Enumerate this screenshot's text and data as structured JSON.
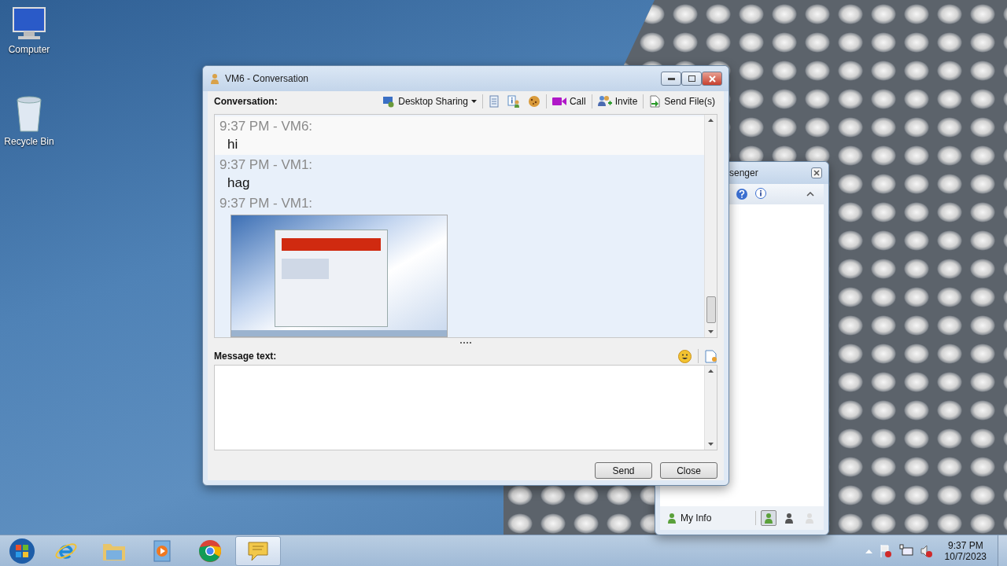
{
  "desktop_icons": [
    {
      "kind": "computer",
      "label": "Computer"
    },
    {
      "kind": "bin",
      "label": "Recycle Bin"
    }
  ],
  "messenger_window": {
    "title": "senger",
    "footer_label": "My Info",
    "statuses": [
      {
        "kind": "online",
        "selected": true
      },
      {
        "kind": "busy",
        "selected": false
      },
      {
        "kind": "offline",
        "selected": false
      }
    ]
  },
  "conversation_window": {
    "title": "VM6 - Conversation",
    "header_label": "Conversation:",
    "toolbar": [
      {
        "kind": "sharing",
        "label": "Desktop Sharing"
      },
      {
        "kind": "notes"
      },
      {
        "kind": "info"
      },
      {
        "kind": "cookie"
      },
      {
        "kind": "call",
        "label": "Call"
      },
      {
        "kind": "invite",
        "label": "Invite"
      },
      {
        "kind": "send",
        "label": "Send File(s)"
      }
    ],
    "messages": [
      {
        "kind": "text",
        "header": "9:37 PM - VM6:",
        "text": "hi",
        "shaded": false
      },
      {
        "kind": "text",
        "header": "9:37 PM - VM1:",
        "text": "hag",
        "shaded": true
      },
      {
        "kind": "image",
        "header": "9:37 PM - VM1:",
        "shaded": true
      }
    ],
    "message_label": "Message text:",
    "buttons": [
      "Send",
      "Close"
    ]
  },
  "taskbar": {
    "apps": [
      {
        "kind": "ie",
        "selected": false
      },
      {
        "kind": "folder",
        "selected": false
      },
      {
        "kind": "media",
        "selected": false
      },
      {
        "kind": "chrome",
        "selected": false
      },
      {
        "kind": "messenger",
        "selected": true
      }
    ],
    "time": "9:37 PM",
    "date": "10/7/2023"
  }
}
